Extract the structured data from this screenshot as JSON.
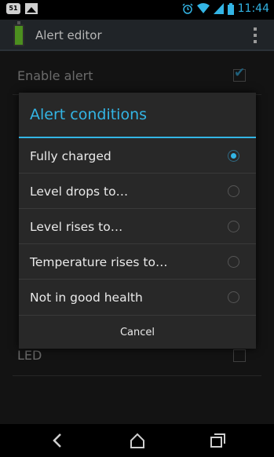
{
  "status_bar": {
    "badge": "51",
    "time": "11:44",
    "icons": [
      "notification-badge-icon",
      "image-icon",
      "alarm-icon",
      "wifi-icon",
      "cellular-signal-icon",
      "battery-icon"
    ],
    "accent": "#33b5e5"
  },
  "action_bar": {
    "title": "Alert editor",
    "icon": "battery-app-icon",
    "overflow_icon": "overflow-menu-icon"
  },
  "settings": {
    "enable_alert_label": "Enable alert",
    "enable_alert_checked": true,
    "led_label": "LED",
    "led_checked": false
  },
  "dialog": {
    "title": "Alert conditions",
    "options": [
      {
        "label": "Fully charged",
        "selected": true
      },
      {
        "label": "Level drops to…",
        "selected": false
      },
      {
        "label": "Level rises to…",
        "selected": false
      },
      {
        "label": "Temperature rises to…",
        "selected": false
      },
      {
        "label": "Not in good health",
        "selected": false
      }
    ],
    "cancel_label": "Cancel",
    "accent": "#33b5e5"
  },
  "navbar": {
    "icons": [
      "back-icon",
      "home-icon",
      "recent-apps-icon"
    ]
  }
}
